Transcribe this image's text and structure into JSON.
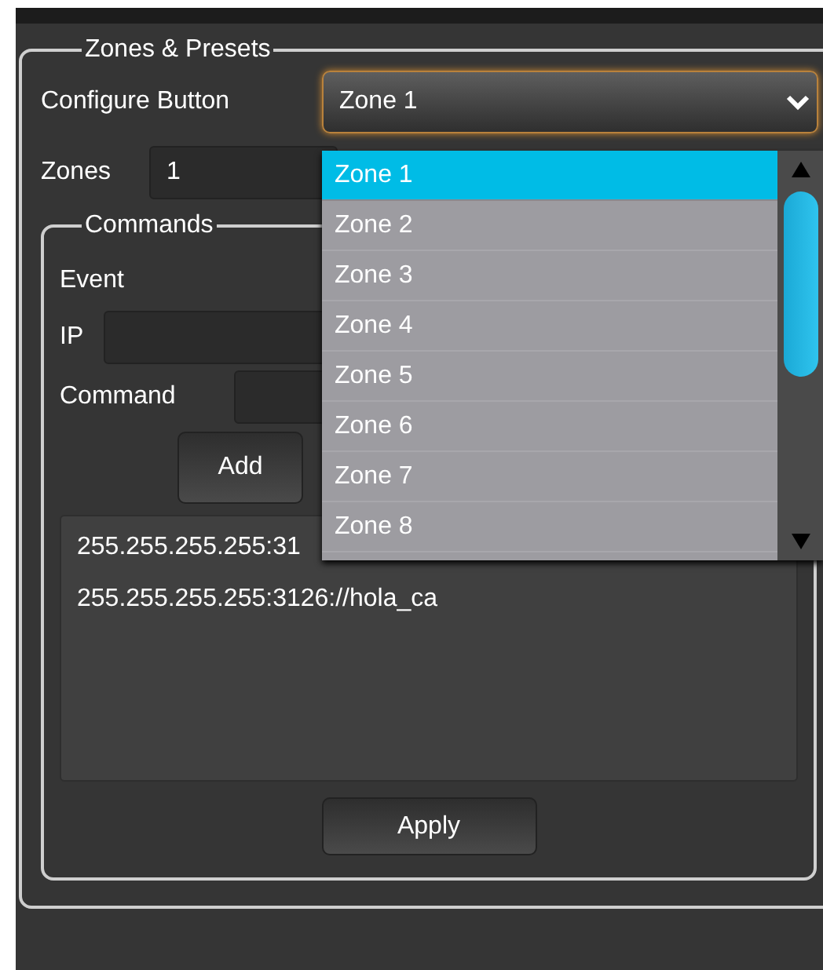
{
  "group": {
    "title": "Zones & Presets"
  },
  "configure_button": {
    "label": "Configure Button",
    "value": "Zone 1"
  },
  "zones": {
    "label": "Zones",
    "value": "1"
  },
  "commands": {
    "title": "Commands",
    "event_label": "Event",
    "ip_label": "IP",
    "command_label": "Command",
    "add_button": "Add",
    "list": [
      {
        "text": "255.255.255.255:31"
      },
      {
        "text": "255.255.255.255:3126://hola_ca"
      }
    ],
    "apply_button": "Apply"
  },
  "dropdown": {
    "items": [
      {
        "label": "Zone 1",
        "selected": true
      },
      {
        "label": "Zone 2",
        "selected": false
      },
      {
        "label": "Zone 3",
        "selected": false
      },
      {
        "label": "Zone 4",
        "selected": false
      },
      {
        "label": "Zone 5",
        "selected": false
      },
      {
        "label": "Zone 6",
        "selected": false
      },
      {
        "label": "Zone 7",
        "selected": false
      },
      {
        "label": "Zone 8",
        "selected": false
      }
    ]
  }
}
